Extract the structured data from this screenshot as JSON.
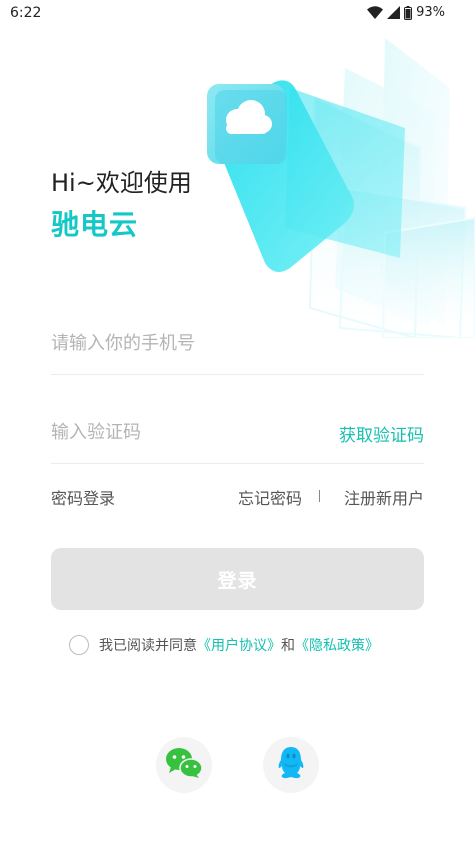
{
  "status_bar": {
    "time": "6:22",
    "battery": "93%",
    "icons": [
      "wifi-icon",
      "cellular-signal-icon",
      "battery-icon"
    ]
  },
  "hero": {
    "icon": "cloud-icon",
    "accent_color": "#14c8c8"
  },
  "greeting": "Hi~欢迎使用",
  "brand_name": "驰电云",
  "phone": {
    "placeholder": "请输入你的手机号",
    "value": ""
  },
  "code": {
    "placeholder": "输入验证码",
    "value": "",
    "get_code_label": "获取验证码"
  },
  "links": {
    "password_login": "密码登录",
    "forgot_password": "忘记密码",
    "divider": "|",
    "register": "注册新用户"
  },
  "login_button": "登录",
  "agreement": {
    "prefix": "我已阅读并同意",
    "user_agreement": "《用户协议》",
    "and": "和",
    "privacy_policy": "《隐私政策》",
    "checked": false
  },
  "social_login": [
    {
      "name": "wechat",
      "icon": "wechat-icon",
      "color": "#36c13f"
    },
    {
      "name": "qq",
      "icon": "qq-icon",
      "color": "#12b7f5"
    }
  ]
}
